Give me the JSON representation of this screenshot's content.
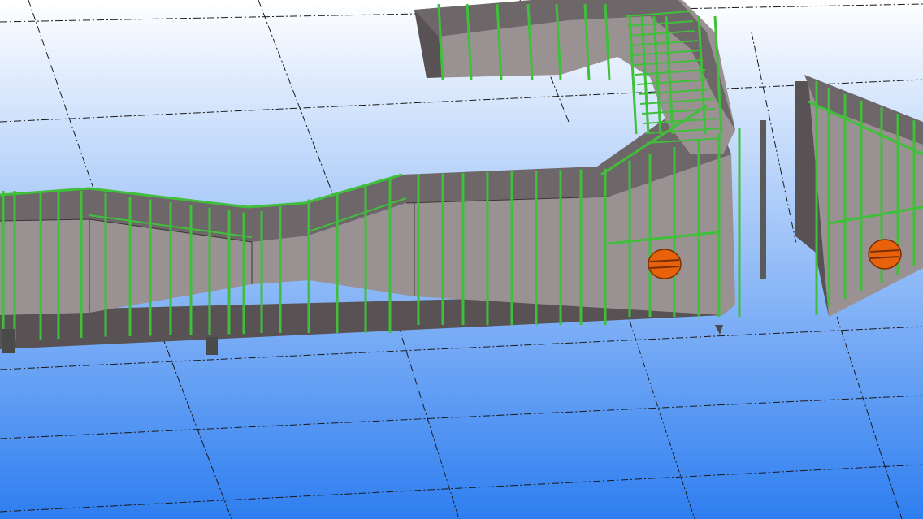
{
  "viewport": {
    "name": "3d-model-viewport",
    "background": {
      "top": "#ffffff",
      "bottom": "#2e7ef0"
    },
    "gridline_color": "#1a1a1a"
  },
  "model": {
    "duct_face_color": "#9a9192",
    "duct_top_color": "#6e6769",
    "duct_dark_color": "#585254",
    "stiffener_color": "#3fbf3a",
    "stiffener_dark_color": "#2d8a2a",
    "damper_color": "#e8620c",
    "damper_outline_color": "#7a2e05"
  }
}
